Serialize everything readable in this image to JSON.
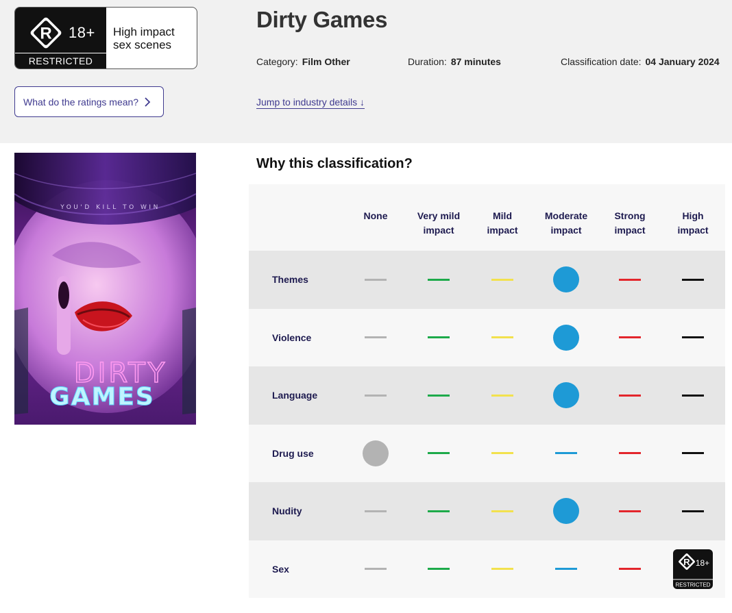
{
  "header": {
    "rating_badge": {
      "symbol": "R",
      "age": "18+",
      "band": "RESTRICTED",
      "consumer_advice_line1": "High impact",
      "consumer_advice_line2": "sex scenes"
    },
    "ratings_button_label": "What do the ratings mean?",
    "title": "Dirty Games",
    "category_label": "Category:",
    "category_value": "Film Other",
    "duration_label": "Duration:",
    "duration_value": "87 minutes",
    "date_label": "Classification date:",
    "date_value": "04 January 2024",
    "jump_link": "Jump to industry details ↓"
  },
  "poster": {
    "tagline": "YOU'D KILL TO WIN",
    "title_line1": "DIRTY",
    "title_line2": "GAMES"
  },
  "classification": {
    "heading": "Why this classification?",
    "columns": [
      {
        "line1": "None",
        "line2": ""
      },
      {
        "line1": "Very mild",
        "line2": "impact"
      },
      {
        "line1": "Mild",
        "line2": "impact"
      },
      {
        "line1": "Moderate",
        "line2": "impact"
      },
      {
        "line1": "Strong",
        "line2": "impact"
      },
      {
        "line1": "High",
        "line2": "impact"
      }
    ],
    "level_colors": [
      "#b3b3b3",
      "#1daa4a",
      "#f2e14d",
      "#1e9ad6",
      "#e3262c",
      "#111111"
    ],
    "rows": [
      {
        "label": "Themes",
        "level": 3
      },
      {
        "label": "Violence",
        "level": 3
      },
      {
        "label": "Language",
        "level": 3
      },
      {
        "label": "Drug use",
        "level": 0
      },
      {
        "label": "Nudity",
        "level": 3
      },
      {
        "label": "Sex",
        "level": 5
      }
    ],
    "high_badge": {
      "symbol": "R",
      "age": "18+",
      "band": "RESTRICTED"
    }
  }
}
